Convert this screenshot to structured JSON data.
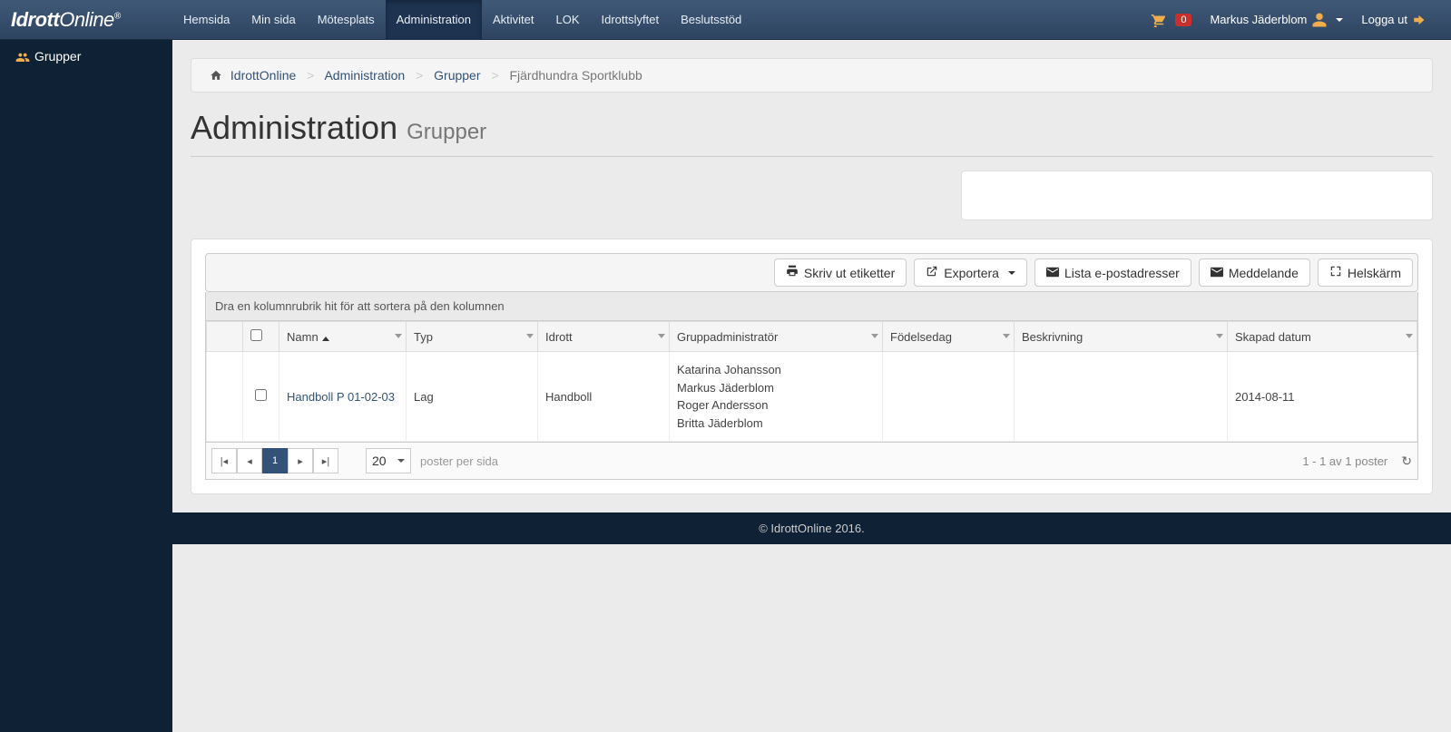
{
  "brand": "IdrottOnline",
  "nav": {
    "items": [
      {
        "label": "Hemsida"
      },
      {
        "label": "Min sida"
      },
      {
        "label": "Mötesplats"
      },
      {
        "label": "Administration",
        "active": true
      },
      {
        "label": "Aktivitet"
      },
      {
        "label": "LOK"
      },
      {
        "label": "Idrottslyftet"
      },
      {
        "label": "Beslutsstöd"
      }
    ]
  },
  "header_right": {
    "cart_count": "0",
    "user_name": "Markus Jäderblom",
    "logout": "Logga ut"
  },
  "sidebar": {
    "items": [
      {
        "label": "Grupper"
      }
    ]
  },
  "breadcrumb": {
    "home": "IdrottOnline",
    "items": [
      "Administration",
      "Grupper",
      "Fjärdhundra Sportklubb"
    ]
  },
  "page_title": {
    "main": "Administration",
    "sub": "Grupper"
  },
  "toolbar": {
    "print": "Skriv ut etiketter",
    "export": "Exportera",
    "emails": "Lista e-postadresser",
    "message": "Meddelande",
    "fullscreen": "Helskärm"
  },
  "table": {
    "group_hint": "Dra en kolumnrubrik hit för att sortera på den kolumnen",
    "columns": {
      "name": "Namn",
      "type": "Typ",
      "sport": "Idrott",
      "admin": "Gruppadministratör",
      "birthday": "Födelsedag",
      "desc": "Beskrivning",
      "created": "Skapad datum"
    },
    "rows": [
      {
        "name": "Handboll P 01-02-03",
        "type": "Lag",
        "sport": "Handboll",
        "admins": [
          "Katarina Johansson",
          "Markus Jäderblom",
          "Roger Andersson",
          "Britta Jäderblom"
        ],
        "birthday": "",
        "desc": "",
        "created": "2014-08-11"
      }
    ]
  },
  "pager": {
    "current": "1",
    "page_size": "20",
    "per_page_label": "poster per sida",
    "info": "1 - 1 av 1 poster"
  },
  "footer": "© IdrottOnline 2016."
}
